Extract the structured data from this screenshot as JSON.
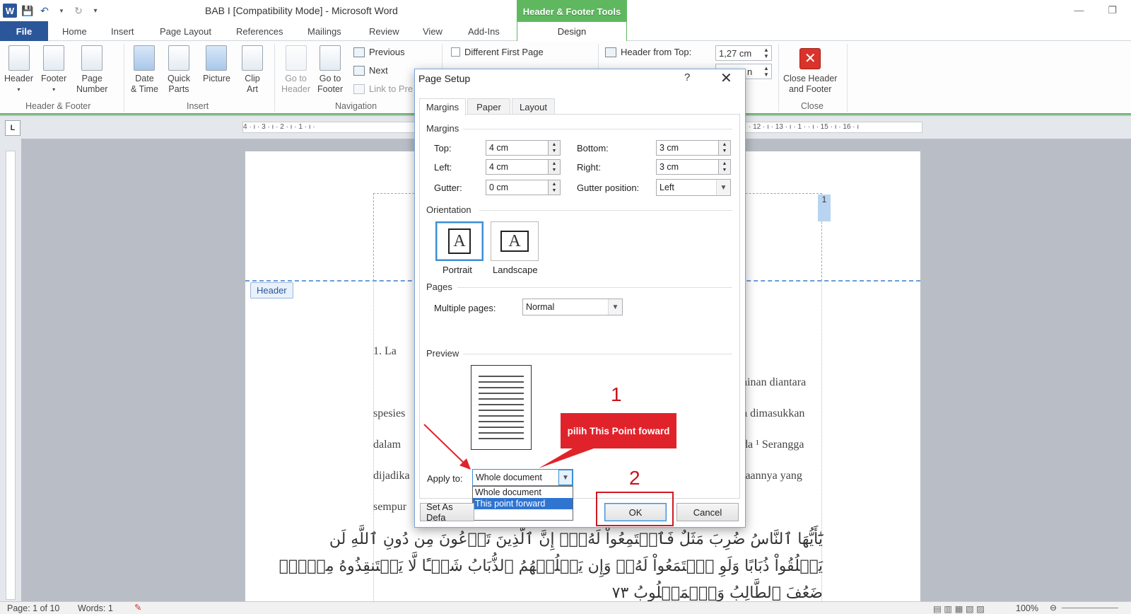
{
  "titlebar": {
    "doc_title": "BAB I [Compatibility Mode]  -  Microsoft Word",
    "context_tab": "Header & Footer Tools",
    "minimize": "—",
    "restore": "❐"
  },
  "tabs": [
    "File",
    "Home",
    "Insert",
    "Page Layout",
    "References",
    "Mailings",
    "Review",
    "View",
    "Add-Ins",
    "Design"
  ],
  "ribbon": {
    "header": "Header",
    "footer": "Footer",
    "page_number": [
      "Page",
      "Number"
    ],
    "date_time": [
      "Date",
      "& Time"
    ],
    "quick_parts": [
      "Quick",
      "Parts"
    ],
    "picture": "Picture",
    "clip_art": [
      "Clip",
      "Art"
    ],
    "go_to_header": [
      "Go to",
      "Header"
    ],
    "go_to_footer": [
      "Go to",
      "Footer"
    ],
    "previous": "Previous",
    "next": "Next",
    "link_to_previous": "Link to Pre",
    "different_first_page": "Different First Page",
    "header_from_top_label": "Header from Top:",
    "header_from_top_value": "1,27 cm",
    "footer_from_bottom_value": "n",
    "close_header_footer": [
      "Close Header",
      "and Footer"
    ],
    "groups": {
      "hf": "Header & Footer",
      "insert": "Insert",
      "navigation": "Navigation",
      "close": "Close"
    }
  },
  "ruler": {
    "corner": "L",
    "ticks_left": "4 · ı · 3 · ı · 2 · ı · 1 · ı ·",
    "ticks_right": "· 12 · ı · 13 · ı · 1 ·   · ı · 15 · ı · 16 · ı"
  },
  "document": {
    "header_tag": "Header",
    "page_number": "1",
    "heading_fragment": "1.    La",
    "right_fragments": [
      "ainan  diantara",
      "a  dimasukkan",
      "da ¹  Serangga",
      "taannya  yang"
    ],
    "left_fragments": [
      "spesies",
      "dalam",
      "dijadika",
      "sempur"
    ],
    "arabic_lines": [
      "يَٰٓأَيُّهَا ٱلنَّاسُ ضُرِبَ مَثَلٌ فَٱسۡتَمِعُواْ لَهُۥٓۚ إِنَّ ٱلَّذِينَ تَدۡعُونَ مِن دُونِ ٱللَّهِ لَن",
      "يَخۡلُقُواْ ذُبَابًا وَلَوِ ٱجۡتَمَعُواْ لَهُۥۖ وَإِن يَسۡلُبۡهُمُ ٱلذُّبَابُ شَيۡـًٔا لَّا يَسۡتَنقِذُوهُ مِنۡهُۚ",
      "ضَعُفَ ٱلطَّالِبُ وَٱلۡمَطۡلُوبُ ٧٣"
    ]
  },
  "dialog": {
    "title": "Page Setup",
    "help": "?",
    "close": "✕",
    "tabs": [
      "Margins",
      "Paper",
      "Layout"
    ],
    "margins_section": "Margins",
    "top_label": "Top:",
    "top_value": "4 cm",
    "bottom_label": "Bottom:",
    "bottom_value": "3 cm",
    "left_label": "Left:",
    "left_value": "4 cm",
    "right_label": "Right:",
    "right_value": "3 cm",
    "gutter_label": "Gutter:",
    "gutter_value": "0 cm",
    "gutter_pos_label": "Gutter position:",
    "gutter_pos_value": "Left",
    "orientation_section": "Orientation",
    "portrait": "Portrait",
    "landscape": "Landscape",
    "pages_section": "Pages",
    "multiple_pages_label": "Multiple pages:",
    "multiple_pages_value": "Normal",
    "preview_section": "Preview",
    "apply_to_label": "Apply to:",
    "apply_to_value": "Whole document",
    "apply_options": [
      "Whole document",
      "This point forward"
    ],
    "set_as_default": "Set As Defa",
    "ok": "OK",
    "cancel": "Cancel"
  },
  "annotations": {
    "callout": "pilih This Point foward",
    "step1": "1",
    "step2": "2",
    "color": "#e0232b"
  },
  "statusbar": {
    "page": "Page: 1 of 10",
    "words": "Words: 1",
    "zoom": "100%"
  }
}
